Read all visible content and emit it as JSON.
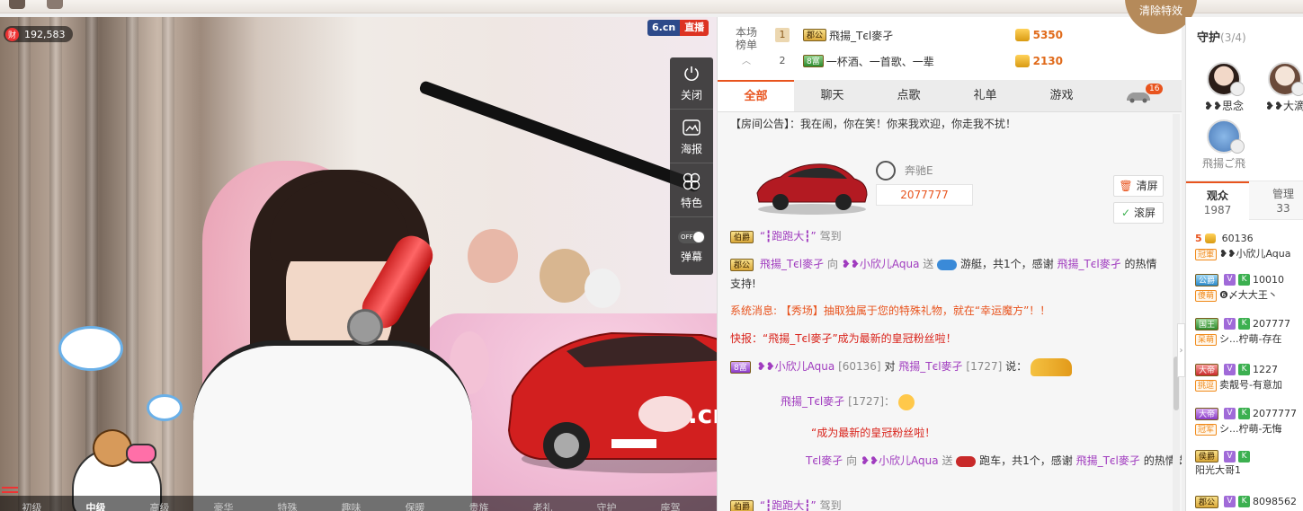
{
  "video": {
    "wealth_label": "财",
    "wealth_value": "192,583",
    "logo_text": "6.cn",
    "live_label": "直播",
    "tools": [
      {
        "label": "关闭",
        "icon": "power-icon"
      },
      {
        "label": "海报",
        "icon": "poster-icon"
      },
      {
        "label": "特色",
        "icon": "flower-icon"
      },
      {
        "label": "弹幕",
        "icon": "toggle-icon",
        "toggle": "OFF"
      }
    ],
    "quality": [
      "初级",
      "中级",
      "高级",
      "豪华",
      "特殊",
      "趣味",
      "保暖",
      "贵族",
      "老礼",
      "守护",
      "座驾"
    ],
    "quality_active": 1,
    "car_overlay_text": ".cn"
  },
  "rank": {
    "title_line1": "本场",
    "title_line2": "榜单",
    "rows": [
      {
        "num": "1",
        "badge": "郡公",
        "badge_color": "gold",
        "name": "飛揚_Tєl麥孑",
        "score": "5350"
      },
      {
        "num": "2",
        "badge": "8富",
        "badge_color": "green",
        "name": "一杯酒、一首歌、一辈",
        "score": "2130"
      }
    ]
  },
  "clear_effect": "清除特效",
  "tabs": {
    "items": [
      "全部",
      "聊天",
      "点歌",
      "礼单",
      "游戏"
    ],
    "active": 0,
    "car_badge": "16"
  },
  "chat": {
    "announce_prefix": "【房间公告】：",
    "announce_text": "我在闹，你在笑！你来我欢迎，你走我不扰！",
    "car_brand": "奔驰E",
    "car_price": "2077777",
    "clear_btn": "清屏",
    "scroll_btn": "滚屏",
    "m1_badge": "伯爵",
    "m1_user": "“┇跑跑大┇”",
    "m1_text": "驾到",
    "m2_badge": "郡公",
    "m2_user": "飛揚_Tєl麥孑",
    "m2_to": "向",
    "m2_target": "❥❥小欣儿Aqua",
    "m2_send": "送",
    "m2_gift": "游艇，共1个，感谢",
    "m2_user2": "飛揚_Tєl麥孑",
    "m2_tail": "的热情支持!",
    "sys_prefix": "系统消息:",
    "sys_text": "【秀场】抽取独属于您的特殊礼物，就在“幸运魔方”！！",
    "news1": "快报：“飛揚_Tєl麥孑”成为最新的皇冠粉丝啦！",
    "m3_badge": "8富",
    "m3_user": "❥❥小欣儿Aqua",
    "m3_id": "[60136]",
    "m3_to": "对",
    "m3_target": "飛揚_Tєl麥孑",
    "m3_target_id": "[1727]",
    "m3_say": "说：",
    "m4_user": "飛揚_Tєl麥孑",
    "m4_id": "[1727]：",
    "news2": "“成为最新的皇冠粉丝啦！",
    "m5_user": "Tєl麥孑",
    "m5_to": "向",
    "m5_target": "❥❥小欣儿Aqua",
    "m5_send": "送",
    "m5_gift": "跑车，共1个，感谢",
    "m5_user2": "飛揚_Tєl麥孑",
    "m5_tail": "的热情支",
    "m6_badge": "伯爵",
    "m6_user": "“┇跑跑大┇”",
    "m6_text": "驾到"
  },
  "guard": {
    "title": "守护",
    "count": "(3/4)",
    "members": [
      "❥❥思念",
      "❥❥大滴",
      "飛揚ご飛"
    ]
  },
  "audience": {
    "tab1": "观众",
    "tab1_count": "1987",
    "tab2": "管理",
    "tab2_count": "33",
    "users": [
      {
        "rank": "5",
        "id": "60136",
        "tag": "冠軍",
        "name": "❥❥小欣儿Aqua",
        "vk": false
      },
      {
        "rank": "",
        "badge": "公爵",
        "id": "10010",
        "tag": "傻萌",
        "name": "❻〆大大王丶",
        "vk": true
      },
      {
        "rank": "",
        "badge": "国王",
        "id": "207777",
        "tag": "呆萌",
        "name": "シ...柠萌-存在",
        "vk": true
      },
      {
        "rank": "",
        "badge": "大帝",
        "id": "1227",
        "tag": "挑逗",
        "name": "卖靓号-有意加",
        "vk": true
      },
      {
        "rank": "",
        "badge": "大帝",
        "id": "2077777",
        "tag": "冠军",
        "name": "シ...柠萌-无悔",
        "vk": true
      },
      {
        "rank": "",
        "badge": "侯爵",
        "id": "",
        "tag": "",
        "name": "阳光大哥1",
        "vk": true
      },
      {
        "rank": "",
        "badge": "郡公",
        "id": "8098562",
        "tag": "",
        "name": "",
        "vk": true
      }
    ]
  },
  "colors": {
    "accent": "#e8541e",
    "purple_name": "#a03cbf",
    "gold_coin": "#e6a21a"
  }
}
